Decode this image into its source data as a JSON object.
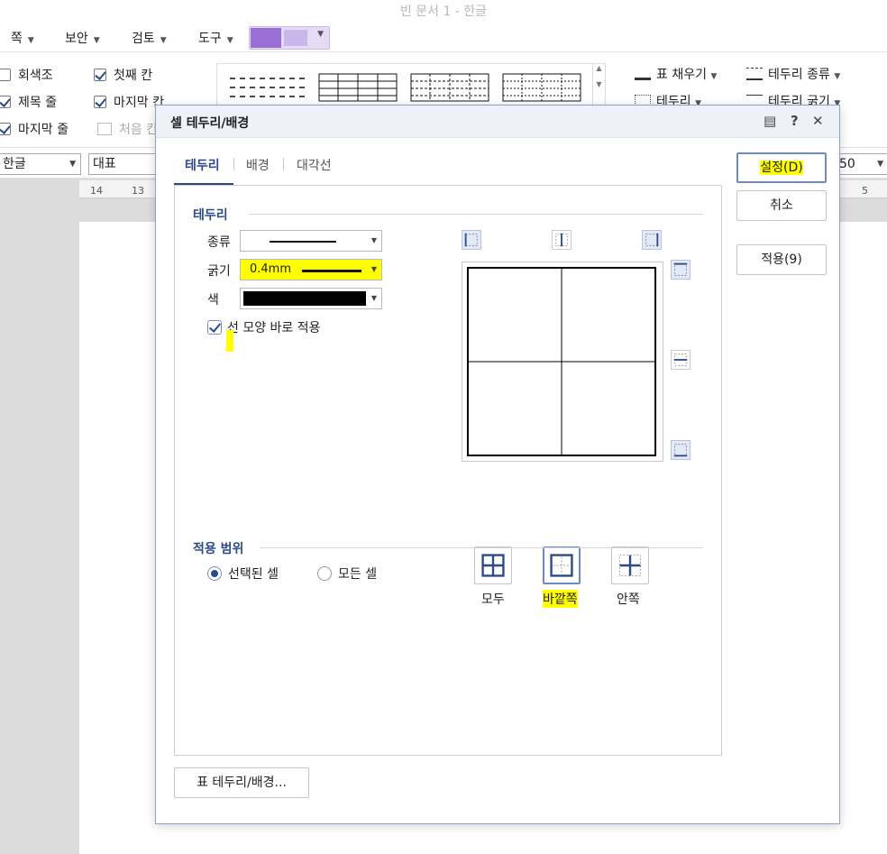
{
  "window": {
    "title": "빈 문서 1 - 한글"
  },
  "menubar": {
    "items": [
      "쪽",
      "보안",
      "검토",
      "도구"
    ]
  },
  "ribbon": {
    "checks": [
      {
        "label": "회색조",
        "checked": false
      },
      {
        "label": "첫째 칸",
        "checked": true
      },
      {
        "label": "제목 줄",
        "checked": true
      },
      {
        "label": "마지막 칸",
        "checked": true
      },
      {
        "label": "마지막 줄",
        "checked": true
      },
      {
        "label": "처음 칸",
        "checked": false
      }
    ],
    "right": {
      "fill_label": "표 채우기",
      "border_type_label": "테두리 종류",
      "border_label": "테두리",
      "border_width_label": "테두리 굵기"
    }
  },
  "fmtbar": {
    "lang": "한글",
    "style": "대표",
    "zoom": "50"
  },
  "ruler": {
    "marks": [
      "14",
      "13",
      "5"
    ]
  },
  "dialog": {
    "title": "셀 테두리/배경",
    "tabs": [
      "테두리",
      "배경",
      "대각선"
    ],
    "active_tab": "테두리",
    "border_section": {
      "title": "테두리",
      "type_label": "종류",
      "width_label": "굵기",
      "width_value": "0.4mm",
      "color_label": "색",
      "color_value": "#000000",
      "apply_now_label": "선 모양 바로 적용",
      "apply_now_checked": true
    },
    "presets": [
      {
        "label": "모두",
        "icon": "all-borders-icon"
      },
      {
        "label": "바깥쪽",
        "icon": "outer-borders-icon",
        "selected": true
      },
      {
        "label": "안쪽",
        "icon": "inner-borders-icon"
      }
    ],
    "scope_section": {
      "title": "적용 범위",
      "options": [
        {
          "label": "선택된 셀",
          "selected": true
        },
        {
          "label": "모든 셀",
          "selected": false
        }
      ]
    },
    "buttons": {
      "ok_label": "설정(D)",
      "cancel_label": "취소",
      "apply_label": "적용(9)",
      "table_border_label": "표 테두리/배경..."
    }
  }
}
